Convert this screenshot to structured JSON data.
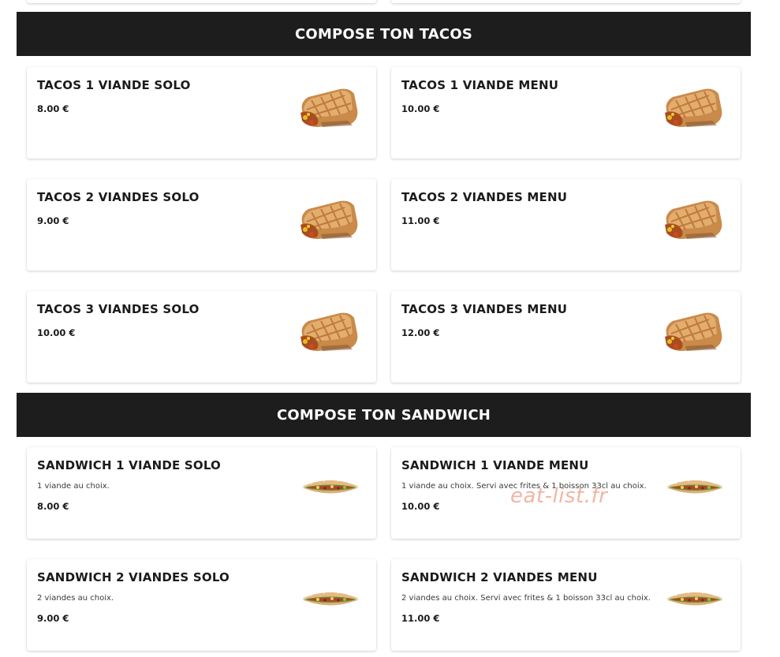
{
  "sections": [
    {
      "title": "COMPOSE TON TACOS",
      "items": [
        {
          "name": "TACOS 1 VIANDE SOLO",
          "price": "8.00 €",
          "image": "tacos-image"
        },
        {
          "name": "TACOS 1 VIANDE MENU",
          "price": "10.00 €",
          "image": "tacos-image"
        },
        {
          "name": "TACOS 2 VIANDES SOLO",
          "price": "9.00 €",
          "image": "tacos-image"
        },
        {
          "name": "TACOS 2 VIANDES MENU",
          "price": "11.00 €",
          "image": "tacos-image"
        },
        {
          "name": "TACOS 3 VIANDES SOLO",
          "price": "10.00 €",
          "image": "tacos-image"
        },
        {
          "name": "TACOS 3 VIANDES MENU",
          "price": "12.00 €",
          "image": "tacos-image"
        }
      ]
    },
    {
      "title": "COMPOSE TON SANDWICH",
      "items": [
        {
          "name": "SANDWICH 1 VIANDE SOLO",
          "desc": "1 viande au choix.",
          "price": "8.00 €",
          "image": "sandwich-image"
        },
        {
          "name": "SANDWICH 1 VIANDE MENU",
          "desc": "1 viande au choix. Servi avec frites & 1 boisson 33cl au choix.",
          "price": "10.00 €",
          "image": "sandwich-image"
        },
        {
          "name": "SANDWICH 2 VIANDES SOLO",
          "desc": "2 viandes au choix.",
          "price": "9.00 €",
          "image": "sandwich-image"
        },
        {
          "name": "SANDWICH 2 VIANDES MENU",
          "desc": "2 viandes au choix. Servi avec frites & 1 boisson 33cl au choix.",
          "price": "11.00 €",
          "image": "sandwich-image"
        }
      ]
    }
  ],
  "watermark": "eat-list.fr",
  "colors": {
    "banner_bg": "#1d1d1d",
    "banner_text": "#ffffff",
    "card_bg": "#ffffff",
    "watermark": "#e6785a"
  }
}
